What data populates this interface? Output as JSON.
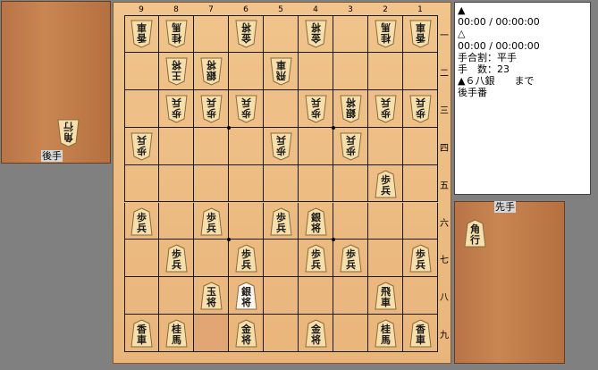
{
  "file_labels": [
    "9",
    "8",
    "7",
    "6",
    "5",
    "4",
    "3",
    "2",
    "1"
  ],
  "rank_labels": [
    "一",
    "二",
    "三",
    "四",
    "五",
    "六",
    "七",
    "八",
    "九"
  ],
  "gote_label": "後手",
  "sente_label": "先手",
  "gote_hand": [
    {
      "char1": "角",
      "char2": "行",
      "gote": true
    }
  ],
  "sente_hand": [
    {
      "char1": "角",
      "char2": "行",
      "gote": false
    }
  ],
  "info": {
    "gote_mark": "▲",
    "gote_time": "00:00 / 00:00:00",
    "sente_mark": "△",
    "sente_time": "00:00 / 00:00:00",
    "handicap": "手合割：平手",
    "moves": "手　数：23",
    "last_move": "▲６八銀　　まで",
    "turn": "後手番"
  },
  "highlight": {
    "file": 7,
    "rank": 9
  },
  "pieces": [
    {
      "file": 9,
      "rank": 1,
      "c1": "香",
      "c2": "車",
      "gote": true
    },
    {
      "file": 8,
      "rank": 1,
      "c1": "桂",
      "c2": "馬",
      "gote": true
    },
    {
      "file": 6,
      "rank": 1,
      "c1": "金",
      "c2": "将",
      "gote": true
    },
    {
      "file": 4,
      "rank": 1,
      "c1": "金",
      "c2": "将",
      "gote": true
    },
    {
      "file": 2,
      "rank": 1,
      "c1": "桂",
      "c2": "馬",
      "gote": true
    },
    {
      "file": 1,
      "rank": 1,
      "c1": "香",
      "c2": "車",
      "gote": true
    },
    {
      "file": 8,
      "rank": 2,
      "c1": "王",
      "c2": "将",
      "gote": true
    },
    {
      "file": 7,
      "rank": 2,
      "c1": "銀",
      "c2": "将",
      "gote": true
    },
    {
      "file": 5,
      "rank": 2,
      "c1": "飛",
      "c2": "車",
      "gote": true
    },
    {
      "file": 8,
      "rank": 3,
      "c1": "歩",
      "c2": "兵",
      "gote": true
    },
    {
      "file": 7,
      "rank": 3,
      "c1": "歩",
      "c2": "兵",
      "gote": true
    },
    {
      "file": 6,
      "rank": 3,
      "c1": "歩",
      "c2": "兵",
      "gote": true
    },
    {
      "file": 4,
      "rank": 3,
      "c1": "歩",
      "c2": "兵",
      "gote": true
    },
    {
      "file": 3,
      "rank": 3,
      "c1": "銀",
      "c2": "将",
      "gote": true
    },
    {
      "file": 2,
      "rank": 3,
      "c1": "歩",
      "c2": "兵",
      "gote": true
    },
    {
      "file": 1,
      "rank": 3,
      "c1": "歩",
      "c2": "兵",
      "gote": true
    },
    {
      "file": 9,
      "rank": 4,
      "c1": "歩",
      "c2": "兵",
      "gote": true
    },
    {
      "file": 5,
      "rank": 4,
      "c1": "歩",
      "c2": "兵",
      "gote": true
    },
    {
      "file": 3,
      "rank": 4,
      "c1": "歩",
      "c2": "兵",
      "gote": true
    },
    {
      "file": 2,
      "rank": 5,
      "c1": "歩",
      "c2": "兵",
      "gote": false
    },
    {
      "file": 9,
      "rank": 6,
      "c1": "歩",
      "c2": "兵",
      "gote": false
    },
    {
      "file": 7,
      "rank": 6,
      "c1": "歩",
      "c2": "兵",
      "gote": false
    },
    {
      "file": 5,
      "rank": 6,
      "c1": "歩",
      "c2": "兵",
      "gote": false
    },
    {
      "file": 4,
      "rank": 6,
      "c1": "銀",
      "c2": "将",
      "gote": false
    },
    {
      "file": 8,
      "rank": 7,
      "c1": "歩",
      "c2": "兵",
      "gote": false
    },
    {
      "file": 6,
      "rank": 7,
      "c1": "歩",
      "c2": "兵",
      "gote": false
    },
    {
      "file": 4,
      "rank": 7,
      "c1": "歩",
      "c2": "兵",
      "gote": false
    },
    {
      "file": 3,
      "rank": 7,
      "c1": "歩",
      "c2": "兵",
      "gote": false
    },
    {
      "file": 1,
      "rank": 7,
      "c1": "歩",
      "c2": "兵",
      "gote": false
    },
    {
      "file": 7,
      "rank": 8,
      "c1": "玉",
      "c2": "将",
      "gote": false
    },
    {
      "file": 6,
      "rank": 8,
      "c1": "銀",
      "c2": "将",
      "gote": false,
      "selected": true
    },
    {
      "file": 2,
      "rank": 8,
      "c1": "飛",
      "c2": "車",
      "gote": false
    },
    {
      "file": 9,
      "rank": 9,
      "c1": "香",
      "c2": "車",
      "gote": false
    },
    {
      "file": 8,
      "rank": 9,
      "c1": "桂",
      "c2": "馬",
      "gote": false
    },
    {
      "file": 6,
      "rank": 9,
      "c1": "金",
      "c2": "将",
      "gote": false
    },
    {
      "file": 4,
      "rank": 9,
      "c1": "金",
      "c2": "将",
      "gote": false
    },
    {
      "file": 2,
      "rank": 9,
      "c1": "桂",
      "c2": "馬",
      "gote": false
    },
    {
      "file": 1,
      "rank": 9,
      "c1": "香",
      "c2": "車",
      "gote": false
    }
  ]
}
